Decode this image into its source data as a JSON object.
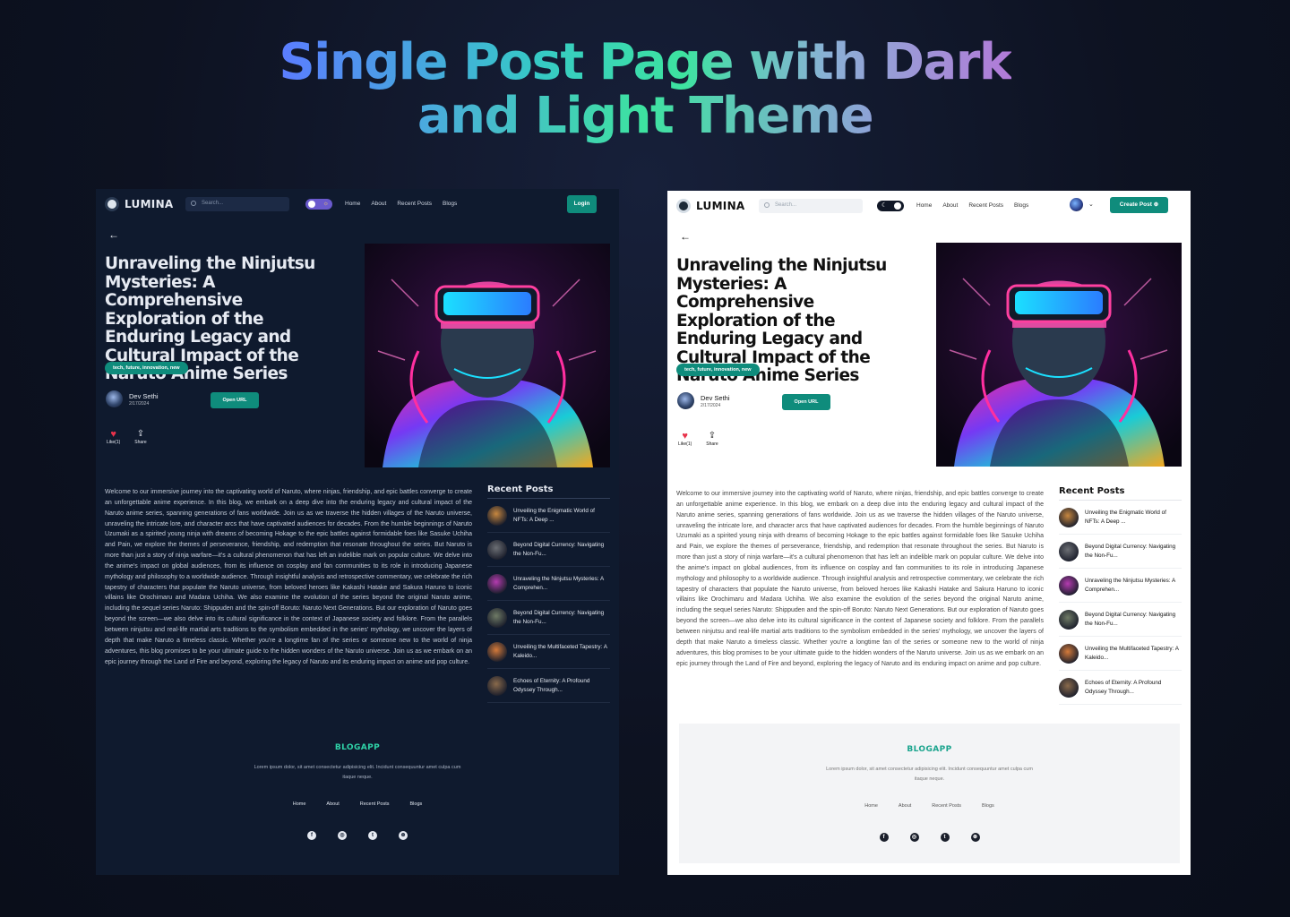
{
  "hero": {
    "line1": "Single Post Page with Dark",
    "line2": "and Light Theme"
  },
  "brand": "LUMINA",
  "search_placeholder": "Search...",
  "nav": [
    "Home",
    "About",
    "Recent Posts",
    "Blogs"
  ],
  "dark_toggle_icon": "☼",
  "light_toggle_icon": "☾",
  "login_label": "Login",
  "create_label": "Create Post ⊕",
  "back_arrow": "←",
  "post": {
    "title": "Unraveling the Ninjutsu Mysteries: A Comprehensive Exploration of the Enduring Legacy and Cultural Impact of the Naruto Anime Series",
    "tags": "tech, future, innovation, new",
    "author": "Dev Sethi",
    "date": "2/17/2024",
    "open_url": "Open URL",
    "like_label": "Like(1)",
    "share_label": "Share",
    "body": "Welcome to our immersive journey into the captivating world of Naruto, where ninjas, friendship, and epic battles converge to create an unforgettable anime experience. In this blog, we embark on a deep dive into the enduring legacy and cultural impact of the Naruto anime series, spanning generations of fans worldwide. Join us as we traverse the hidden villages of the Naruto universe, unraveling the intricate lore, and character arcs that have captivated audiences for decades. From the humble beginnings of Naruto Uzumaki as a spirited young ninja with dreams of becoming Hokage to the epic battles against formidable foes like Sasuke Uchiha and Pain, we explore the themes of perseverance, friendship, and redemption that resonate throughout the series. But Naruto is more than just a story of ninja warfare—it's a cultural phenomenon that has left an indelible mark on popular culture. We delve into the anime's impact on global audiences, from its influence on cosplay and fan communities to its role in introducing Japanese mythology and philosophy to a worldwide audience. Through insightful analysis and retrospective commentary, we celebrate the rich tapestry of characters that populate the Naruto universe, from beloved heroes like Kakashi Hatake and Sakura Haruno to iconic villains like Orochimaru and Madara Uchiha. We also examine the evolution of the series beyond the original Naruto anime, including the sequel series Naruto: Shippuden and the spin-off Boruto: Naruto Next Generations. But our exploration of Naruto goes beyond the screen—we also delve into its cultural significance in the context of Japanese society and folklore. From the parallels between ninjutsu and real-life martial arts traditions to the symbolism embedded in the series' mythology, we uncover the layers of depth that make Naruto a timeless classic. Whether you're a longtime fan of the series or someone new to the world of ninja adventures, this blog promises to be your ultimate guide to the hidden wonders of the Naruto universe. Join us as we embark on an epic journey through the Land of Fire and beyond, exploring the legacy of Naruto and its enduring impact on anime and pop culture."
  },
  "recent": {
    "heading": "Recent Posts",
    "items": [
      {
        "title": "Unveiling the Enigmatic World of NFTs: A Deep ...",
        "color": "#c7873f"
      },
      {
        "title": "Beyond Digital Currency: Navigating the Non-Fu...",
        "color": "#6c6f74"
      },
      {
        "title": "Unraveling the Ninjutsu Mysteries: A Comprehen...",
        "color": "#b43bb0"
      },
      {
        "title": "Beyond Digital Currency: Navigating the Non-Fu...",
        "color": "#6f7b66"
      },
      {
        "title": "Unveiling the Multifaceted Tapestry: A Kaleido...",
        "color": "#d47a3a"
      },
      {
        "title": "Echoes of Eternity: A Profound Odyssey Through...",
        "color": "#8a6a4b"
      }
    ]
  },
  "footer": {
    "brand": "BLOGAPP",
    "desc": "Lorem ipsum dolor, sit amet consectetur adipisicing elit. Incidunt consequuntur amet culpa cum itaque neque.",
    "links": [
      "Home",
      "About",
      "Recent Posts",
      "Blogs"
    ],
    "social": [
      {
        "name": "facebook-icon",
        "glyph": "f"
      },
      {
        "name": "instagram-icon",
        "glyph": "◎"
      },
      {
        "name": "twitter-icon",
        "glyph": "t"
      },
      {
        "name": "dribbble-icon",
        "glyph": "⊛"
      }
    ]
  },
  "colors": {
    "accent": "#0f8c7c",
    "dark_bg": "#0f1a2e",
    "heart": "#e8324b"
  }
}
